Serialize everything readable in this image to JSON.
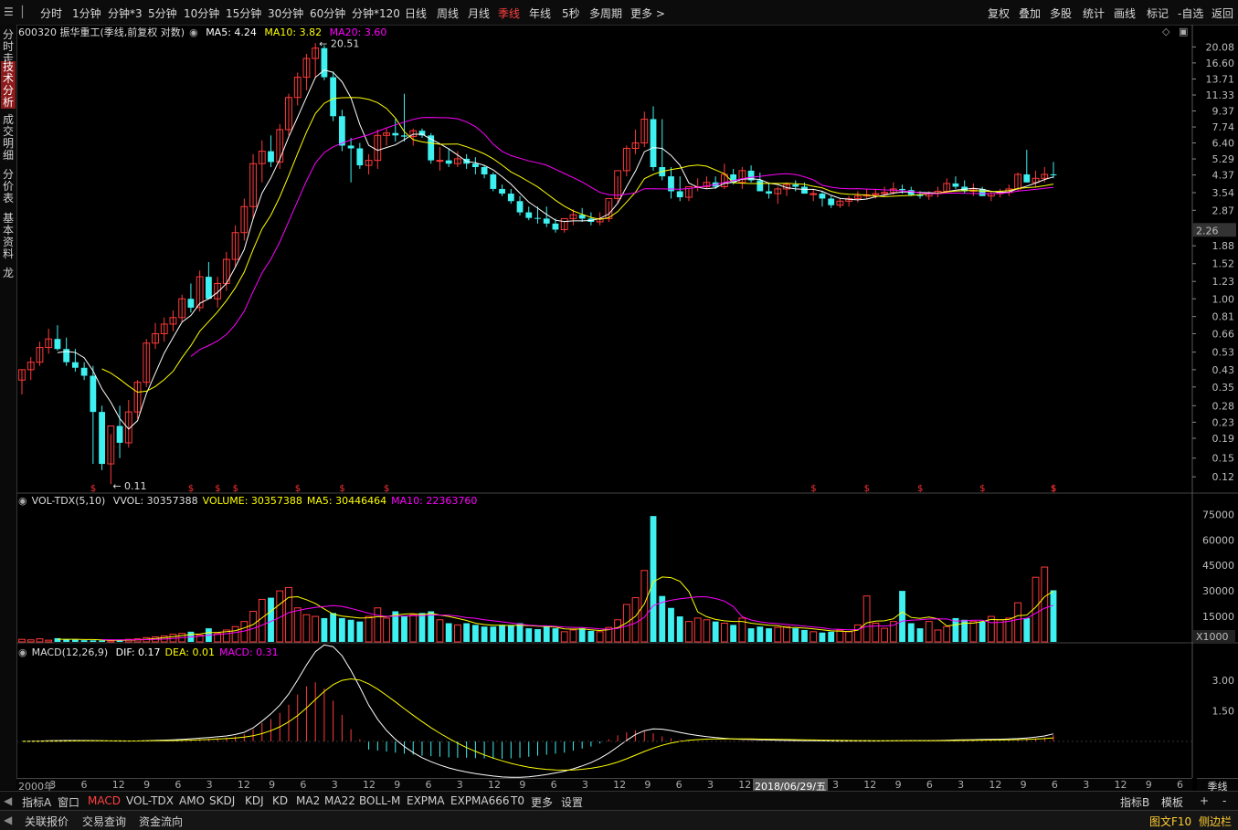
{
  "toolbar": {
    "items": [
      "分时",
      "1分钟",
      "分钟*3",
      "5分钟",
      "10分钟",
      "15分钟",
      "30分钟",
      "60分钟",
      "分钟*120",
      "日线",
      "周线",
      "月线",
      "季线",
      "年线",
      "5秒",
      "多周期",
      "更多 >"
    ],
    "active_index": 12,
    "right_items": [
      "复权",
      "叠加",
      "多股",
      "统计",
      "画线",
      "标记",
      "-自选",
      "返回"
    ]
  },
  "side_tabs": [
    {
      "label": "分时走势",
      "active": false
    },
    {
      "label": "技术分析",
      "active": true
    },
    {
      "label": "成交明细",
      "active": false
    },
    {
      "label": "分价表",
      "active": false
    },
    {
      "label": "基本资料",
      "active": false
    },
    {
      "label": "龙",
      "active": false
    }
  ],
  "price_panel": {
    "stock": "600320 振华重工(季线,前复权 对数)",
    "ma5": "MA5: 4.24",
    "ma10": "MA10: 3.82",
    "ma20": "MA20: 3.60",
    "high_mark": "20.51",
    "low_mark": "0.11",
    "current_price": "2.26",
    "axis_ticks": [
      "20.08",
      "16.60",
      "13.71",
      "11.33",
      "9.37",
      "7.74",
      "6.40",
      "5.29",
      "4.37",
      "3.54",
      "2.87",
      "2.32",
      "1.88",
      "1.52",
      "1.23",
      "1.00",
      "0.81",
      "0.66",
      "0.53",
      "0.43",
      "0.35",
      "0.28",
      "0.23",
      "0.19",
      "0.15",
      "0.12"
    ]
  },
  "volume_panel": {
    "title": "VOL-TDX(5,10)",
    "vvol": "VVOL: 30357388",
    "volume": "VOLUME: 30357388",
    "ma5": "MA5: 30446464",
    "ma10": "MA10: 22363760",
    "axis_ticks": [
      "75000",
      "60000",
      "45000",
      "30000",
      "15000"
    ],
    "unit": "X1000"
  },
  "macd_panel": {
    "title": "MACD(12,26,9)",
    "dif": "DIF: 0.17",
    "dea": "DEA: 0.01",
    "macd": "MACD: 0.31",
    "axis_ticks": [
      "3.00",
      "1.50"
    ]
  },
  "date_axis": {
    "labels": [
      "2000年",
      "3",
      "6",
      "12",
      "9",
      "6",
      "3",
      "12",
      "9",
      "6",
      "3",
      "12",
      "9",
      "6",
      "3",
      "12",
      "9",
      "6",
      "3",
      "12",
      "9",
      "6",
      "3",
      "12",
      "9",
      "6",
      "3",
      "12",
      "9",
      "6",
      "3",
      "12",
      "9",
      "6",
      "3",
      "12",
      "9",
      "6"
    ],
    "highlight": "2018/06/29/五",
    "period": "季线"
  },
  "bottom_tabs": {
    "items": [
      "指标A",
      "窗口",
      "MACD",
      "VOL-TDX",
      "AMO",
      "SKDJ",
      "KDJ",
      "KD",
      "MA2",
      "MA22",
      "BOLL-M",
      "EXPMA",
      "EXPMA666",
      "T0",
      "更多",
      "设置"
    ],
    "active_index": 2,
    "right_items": [
      "指标B",
      "模板",
      "+",
      "-"
    ]
  },
  "status_bar": {
    "items": [
      "关联报价",
      "交易查询",
      "资金流向"
    ],
    "right_items": [
      "图文F10",
      "侧边栏"
    ]
  },
  "colors": {
    "up": "#ff3a3a",
    "down": "#3ff0f0",
    "ma5": "#ffffff",
    "ma10": "#ffff00",
    "ma20": "#ff00ff",
    "dif": "#ffffff",
    "dea": "#ffff00",
    "macd_label": "#ff00ff"
  },
  "chart_data": {
    "type": "candlestick",
    "series_price": {
      "open": [
        0.38,
        0.43,
        0.47,
        0.56,
        0.62,
        0.55,
        0.47,
        0.44,
        0.4,
        0.26,
        0.14,
        0.22,
        0.18,
        0.26,
        0.37,
        0.59,
        0.66,
        0.74,
        0.8,
        1.0,
        0.9,
        1.3,
        1.0,
        1.2,
        1.6,
        2.2,
        3.0,
        5.0,
        5.8,
        5.1,
        7.5,
        11.0,
        14.0,
        17.5,
        19.8,
        14.0,
        8.8,
        6.2,
        6.0,
        4.9,
        5.2,
        7.0,
        7.2,
        7.0,
        6.9,
        7.4,
        7.0,
        5.2,
        5.2,
        5.0,
        5.3,
        5.0,
        4.8,
        4.4,
        3.7,
        3.5,
        3.2,
        2.8,
        2.62,
        2.6,
        2.45,
        2.28,
        2.6,
        2.72,
        2.6,
        2.5,
        2.6,
        3.3,
        4.6,
        6.0,
        6.4,
        8.5,
        4.8,
        4.3,
        3.6,
        3.35,
        3.8,
        3.8,
        4.0,
        3.8,
        4.4,
        4.0,
        4.6,
        4.1,
        3.6,
        3.5,
        3.7,
        3.9,
        3.8,
        3.5,
        3.5,
        3.3,
        3.05,
        3.2,
        3.3,
        3.4,
        3.45,
        3.5,
        3.55,
        3.7,
        3.65,
        3.45,
        3.4,
        3.5,
        3.6,
        3.95,
        3.8,
        3.6,
        3.7,
        3.4,
        3.5,
        3.55,
        3.7,
        4.4,
        4.0,
        4.2,
        4.4
      ],
      "high": [
        0.43,
        0.5,
        0.6,
        0.7,
        0.73,
        0.63,
        0.55,
        0.47,
        0.45,
        0.28,
        0.2,
        0.28,
        0.3,
        0.38,
        0.62,
        0.75,
        0.8,
        0.87,
        1.05,
        1.2,
        1.4,
        1.55,
        1.3,
        1.75,
        2.4,
        3.3,
        5.6,
        6.6,
        7.0,
        8.0,
        11.5,
        14.8,
        18.5,
        21.0,
        20.51,
        15.0,
        9.5,
        6.8,
        6.4,
        5.6,
        7.5,
        7.6,
        8.5,
        11.5,
        7.6,
        7.6,
        7.2,
        6.1,
        6.0,
        5.8,
        5.6,
        5.4,
        4.9,
        4.5,
        3.9,
        3.7,
        3.4,
        3.0,
        3.0,
        3.0,
        2.6,
        2.5,
        2.9,
        2.95,
        2.8,
        2.8,
        3.2,
        4.3,
        6.2,
        7.5,
        9.3,
        9.9,
        8.5,
        4.8,
        4.3,
        3.7,
        4.2,
        4.3,
        4.3,
        5.0,
        4.7,
        4.8,
        4.9,
        4.5,
        4.0,
        3.8,
        4.0,
        4.1,
        4.0,
        3.7,
        3.6,
        3.4,
        3.3,
        3.4,
        3.6,
        3.7,
        3.7,
        3.8,
        4.0,
        3.9,
        3.8,
        3.6,
        3.6,
        3.8,
        4.2,
        4.3,
        4.1,
        3.95,
        3.8,
        3.6,
        3.7,
        3.9,
        4.5,
        5.9,
        4.6,
        4.8,
        5.1
      ],
      "low": [
        0.32,
        0.38,
        0.45,
        0.52,
        0.54,
        0.45,
        0.42,
        0.38,
        0.14,
        0.13,
        0.11,
        0.15,
        0.17,
        0.24,
        0.35,
        0.55,
        0.6,
        0.68,
        0.76,
        0.85,
        0.86,
        1.0,
        0.9,
        1.1,
        1.45,
        2.0,
        2.6,
        4.0,
        4.8,
        4.7,
        7.0,
        10.0,
        12.0,
        14.0,
        13.5,
        8.3,
        5.8,
        4.0,
        4.7,
        4.4,
        4.7,
        6.2,
        6.5,
        6.5,
        6.2,
        6.8,
        5.0,
        4.6,
        4.8,
        4.8,
        4.7,
        4.4,
        4.2,
        3.6,
        3.4,
        3.1,
        2.7,
        2.55,
        2.45,
        2.35,
        2.2,
        2.2,
        2.4,
        2.5,
        2.4,
        2.4,
        2.5,
        3.1,
        4.3,
        5.6,
        6.1,
        4.6,
        4.1,
        3.3,
        3.2,
        3.2,
        3.6,
        3.7,
        3.7,
        3.7,
        3.9,
        3.7,
        4.0,
        3.6,
        3.3,
        3.1,
        3.4,
        3.6,
        3.5,
        3.2,
        3.0,
        2.95,
        2.95,
        3.0,
        3.15,
        3.3,
        3.3,
        3.4,
        3.45,
        3.5,
        3.4,
        3.3,
        3.25,
        3.35,
        3.5,
        3.7,
        3.5,
        3.4,
        3.4,
        3.2,
        3.35,
        3.4,
        3.6,
        4.0,
        3.8,
        4.0,
        4.2
      ],
      "close": [
        0.43,
        0.47,
        0.56,
        0.62,
        0.55,
        0.47,
        0.44,
        0.4,
        0.26,
        0.14,
        0.22,
        0.18,
        0.26,
        0.37,
        0.59,
        0.66,
        0.74,
        0.8,
        1.0,
        0.9,
        1.3,
        1.0,
        1.2,
        1.6,
        2.2,
        3.0,
        5.0,
        5.8,
        5.1,
        7.5,
        11.0,
        14.0,
        17.5,
        19.8,
        14.0,
        8.8,
        6.2,
        6.0,
        4.9,
        5.2,
        7.0,
        7.2,
        7.0,
        6.9,
        7.4,
        7.0,
        5.2,
        5.2,
        5.0,
        5.3,
        5.0,
        4.8,
        4.4,
        3.7,
        3.5,
        3.2,
        2.8,
        2.62,
        2.6,
        2.45,
        2.28,
        2.6,
        2.72,
        2.6,
        2.5,
        2.6,
        3.3,
        4.6,
        6.0,
        6.4,
        8.5,
        4.8,
        4.3,
        3.6,
        3.35,
        3.8,
        3.8,
        4.0,
        3.8,
        4.4,
        4.0,
        4.6,
        4.1,
        3.6,
        3.5,
        3.7,
        3.9,
        3.8,
        3.5,
        3.5,
        3.3,
        3.05,
        3.2,
        3.3,
        3.4,
        3.45,
        3.5,
        3.55,
        3.7,
        3.65,
        3.45,
        3.4,
        3.5,
        3.6,
        3.95,
        3.8,
        3.6,
        3.7,
        3.4,
        3.5,
        3.55,
        3.7,
        4.4,
        4.0,
        4.2,
        4.4,
        4.37
      ]
    },
    "ma_current": {
      "ma5": 4.24,
      "ma10": 3.82,
      "ma20": 3.6
    },
    "volume_k": [
      1500,
      1200,
      1800,
      1000,
      2200,
      1600,
      1300,
      1000,
      900,
      800,
      700,
      1200,
      1500,
      1800,
      2500,
      3000,
      3500,
      4500,
      5000,
      6000,
      4000,
      8000,
      5000,
      7000,
      9000,
      12000,
      18000,
      25000,
      26000,
      30000,
      32000,
      20000,
      16000,
      15000,
      14000,
      17000,
      14000,
      13000,
      12000,
      15000,
      20000,
      14000,
      18000,
      15000,
      16000,
      17000,
      18000,
      13000,
      11000,
      10000,
      11000,
      10000,
      9000,
      9000,
      10000,
      10000,
      11000,
      8000,
      7500,
      9000,
      8000,
      6000,
      7000,
      8000,
      6500,
      6000,
      8500,
      13000,
      22000,
      26000,
      42000,
      74000,
      27000,
      20000,
      15000,
      12000,
      14000,
      13000,
      12000,
      11000,
      10000,
      14000,
      8000,
      9000,
      8000,
      8500,
      9000,
      8000,
      7000,
      6000,
      5500,
      6000,
      7000,
      6000,
      10000,
      27000,
      11000,
      8000,
      12000,
      30000,
      11000,
      8000,
      12000,
      7000,
      9000,
      14000,
      13000,
      12000,
      12000,
      15000,
      13000,
      14000,
      23000,
      14000,
      38000,
      44000,
      30357
    ],
    "macd_hist": [
      0.01,
      0.01,
      0.02,
      0.03,
      0.03,
      0.03,
      0.02,
      0.02,
      0.01,
      0.0,
      0.0,
      0.0,
      0.01,
      0.02,
      0.03,
      0.04,
      0.05,
      0.06,
      0.08,
      0.09,
      0.12,
      0.13,
      0.15,
      0.18,
      0.25,
      0.35,
      0.6,
      0.9,
      1.1,
      1.4,
      1.8,
      2.3,
      2.7,
      2.9,
      2.6,
      2.0,
      1.3,
      0.6,
      0.1,
      -0.4,
      -0.45,
      -0.5,
      -0.55,
      -0.6,
      -0.65,
      -0.7,
      -0.72,
      -0.75,
      -0.78,
      -0.8,
      -0.8,
      -0.82,
      -0.83,
      -0.85,
      -0.85,
      -0.83,
      -0.8,
      -0.75,
      -0.7,
      -0.65,
      -0.6,
      -0.55,
      -0.45,
      -0.35,
      -0.25,
      -0.1,
      0.1,
      0.3,
      0.45,
      0.55,
      0.5,
      0.4,
      0.25,
      0.15,
      0.08,
      0.05,
      0.04,
      0.03,
      0.02,
      0.02,
      0.02,
      0.02,
      0.03,
      0.02,
      0.02,
      0.01,
      0.01,
      0.01,
      0.01,
      0.01,
      0.0,
      0.0,
      0.0,
      0.01,
      0.01,
      0.01,
      0.01,
      0.01,
      0.02,
      0.03,
      0.02,
      0.02,
      0.02,
      0.03,
      0.04,
      0.05,
      0.04,
      0.05,
      0.06,
      0.05,
      0.06,
      0.07,
      0.09,
      0.12,
      0.15,
      0.2,
      0.31
    ]
  }
}
